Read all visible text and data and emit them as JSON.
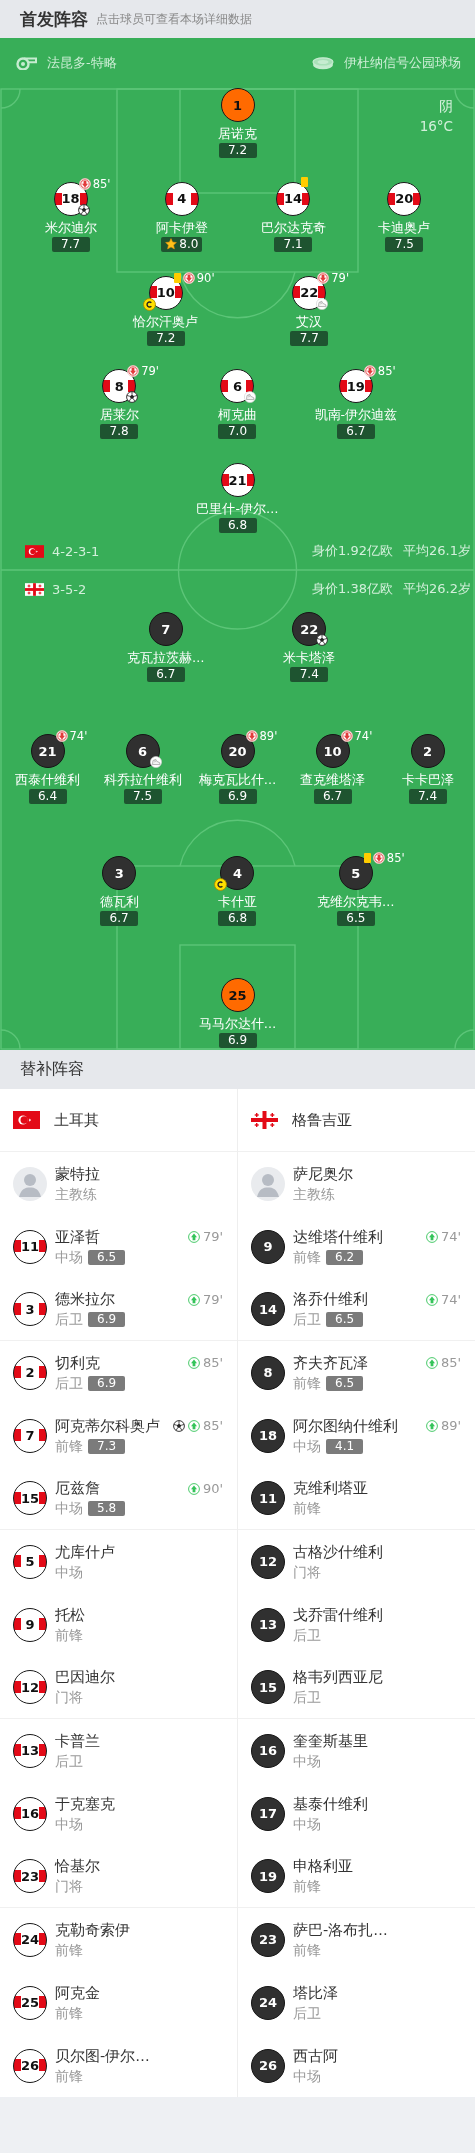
{
  "header": {
    "title": "首发阵容",
    "hint": "点击球员可查看本场详细数据"
  },
  "match_info": {
    "referee": "法昆多-特略",
    "stadium": "伊杜纳信号公园球场",
    "weather": "阴",
    "temperature": "16°C"
  },
  "lineups": [
    {
      "kind": "turkey",
      "formation": "4-2-3-1",
      "market_value": "身价1.92亿欧",
      "average_age": "平均26.1岁",
      "rows": [
        {
          "players": [
            {
              "number": "1",
              "name": "居诺克",
              "rating": "7.2",
              "goalkeeper": true,
              "captain": false,
              "best": false
            }
          ]
        },
        {
          "players": [
            {
              "number": "18",
              "name": "米尔迪尔",
              "rating": "7.7",
              "goalkeeper": false,
              "captain": false,
              "best": false,
              "events": [
                {
                  "kind": "sub_off",
                  "minute": "85'"
                },
                {
                  "kind": "goal"
                }
              ]
            },
            {
              "number": "4",
              "name": "阿卡伊登",
              "rating": "8.0",
              "goalkeeper": false,
              "captain": false,
              "best": true
            },
            {
              "number": "14",
              "name": "巴尔达克奇",
              "rating": "7.1",
              "goalkeeper": false,
              "captain": false,
              "best": false,
              "events": [
                {
                  "kind": "yellow_card"
                }
              ]
            },
            {
              "number": "20",
              "name": "卡迪奥卢",
              "rating": "7.5",
              "goalkeeper": false,
              "captain": false,
              "best": false
            }
          ]
        },
        {
          "players": [
            {
              "number": "10",
              "name": "恰尔汗奥卢",
              "rating": "7.2",
              "goalkeeper": false,
              "captain": true,
              "best": false,
              "events": [
                {
                  "kind": "yellow_card"
                },
                {
                  "kind": "sub_off",
                  "minute": "90'"
                }
              ]
            },
            {
              "number": "22",
              "name": "艾汉",
              "rating": "7.7",
              "goalkeeper": false,
              "captain": false,
              "best": false,
              "events": [
                {
                  "kind": "sub_off",
                  "minute": "79'"
                },
                {
                  "kind": "assist"
                }
              ]
            }
          ]
        },
        {
          "players": [
            {
              "number": "8",
              "name": "居莱尔",
              "rating": "7.8",
              "goalkeeper": false,
              "captain": false,
              "best": false,
              "events": [
                {
                  "kind": "sub_off",
                  "minute": "79'"
                },
                {
                  "kind": "goal"
                }
              ]
            },
            {
              "number": "6",
              "name": "柯克曲",
              "rating": "7.0",
              "goalkeeper": false,
              "captain": false,
              "best": false,
              "events": [
                {
                  "kind": "assist"
                }
              ]
            },
            {
              "number": "19",
              "name": "凯南-伊尔迪兹",
              "rating": "6.7",
              "goalkeeper": false,
              "captain": false,
              "best": false,
              "events": [
                {
                  "kind": "sub_off",
                  "minute": "85'"
                }
              ]
            }
          ]
        },
        {
          "players": [
            {
              "number": "21",
              "name": "巴里什-伊尔…",
              "rating": "6.8",
              "goalkeeper": false,
              "captain": false,
              "best": false
            }
          ]
        }
      ]
    },
    {
      "kind": "georgia",
      "formation": "3-5-2",
      "market_value": "身价1.38亿欧",
      "average_age": "平均26.2岁",
      "rows": [
        {
          "players": [
            {
              "number": "7",
              "name": "克瓦拉茨赫…",
              "rating": "6.7",
              "goalkeeper": false,
              "captain": false,
              "best": false
            },
            {
              "number": "22",
              "name": "米卡塔泽",
              "rating": "7.4",
              "goalkeeper": false,
              "captain": false,
              "best": false,
              "events": [
                {
                  "kind": "goal"
                }
              ]
            }
          ]
        },
        {
          "players": [
            {
              "number": "21",
              "name": "西泰什维利",
              "rating": "6.4",
              "goalkeeper": false,
              "captain": false,
              "best": false,
              "events": [
                {
                  "kind": "sub_off",
                  "minute": "74'"
                }
              ]
            },
            {
              "number": "6",
              "name": "科乔拉什维利",
              "rating": "7.5",
              "goalkeeper": false,
              "captain": false,
              "best": false,
              "events": [
                {
                  "kind": "assist"
                }
              ]
            },
            {
              "number": "20",
              "name": "梅克瓦比什…",
              "rating": "6.9",
              "goalkeeper": false,
              "captain": false,
              "best": false,
              "events": [
                {
                  "kind": "sub_off",
                  "minute": "89'"
                }
              ]
            },
            {
              "number": "10",
              "name": "查克维塔泽",
              "rating": "6.7",
              "goalkeeper": false,
              "captain": false,
              "best": false,
              "events": [
                {
                  "kind": "sub_off",
                  "minute": "74'"
                }
              ]
            },
            {
              "number": "2",
              "name": "卡卡巴泽",
              "rating": "7.4",
              "goalkeeper": false,
              "captain": false,
              "best": false
            }
          ]
        },
        {
          "players": [
            {
              "number": "3",
              "name": "德瓦利",
              "rating": "6.7",
              "goalkeeper": false,
              "captain": false,
              "best": false
            },
            {
              "number": "4",
              "name": "卡什亚",
              "rating": "6.8",
              "goalkeeper": false,
              "captain": true,
              "best": false
            },
            {
              "number": "5",
              "name": "克维尔克韦…",
              "rating": "6.5",
              "goalkeeper": false,
              "captain": false,
              "best": false,
              "events": [
                {
                  "kind": "yellow_card"
                },
                {
                  "kind": "sub_off",
                  "minute": "85'"
                }
              ]
            }
          ]
        },
        {
          "players": [
            {
              "number": "25",
              "name": "马马尔达什…",
              "rating": "6.9",
              "goalkeeper": true,
              "captain": false,
              "best": false
            }
          ]
        }
      ]
    }
  ],
  "substitutes": {
    "title": "替补阵容",
    "teams": [
      {
        "name": "土耳其",
        "kind": "turkey",
        "coach": {
          "name": "蒙特拉",
          "role": "主教练"
        },
        "players": [
          {
            "number": "11",
            "name": "亚泽哲",
            "position": "中场",
            "rating": "6.5",
            "events": [
              {
                "kind": "sub_on",
                "minute": "79'"
              }
            ]
          },
          {
            "number": "3",
            "name": "德米拉尔",
            "position": "后卫",
            "rating": "6.9",
            "events": [
              {
                "kind": "sub_on",
                "minute": "79'"
              }
            ]
          },
          {
            "number": "2",
            "name": "切利克",
            "position": "后卫",
            "rating": "6.9",
            "events": [
              {
                "kind": "sub_on",
                "minute": "85'"
              }
            ]
          },
          {
            "number": "7",
            "name": "阿克蒂尔科奥卢",
            "position": "前锋",
            "rating": "7.3",
            "events": [
              {
                "kind": "goal"
              },
              {
                "kind": "sub_on",
                "minute": "85'"
              }
            ]
          },
          {
            "number": "15",
            "name": "厄兹詹",
            "position": "中场",
            "rating": "5.8",
            "events": [
              {
                "kind": "sub_on",
                "minute": "90'"
              }
            ]
          },
          {
            "number": "5",
            "name": "尤库什卢",
            "position": "中场"
          },
          {
            "number": "9",
            "name": "托松",
            "position": "前锋"
          },
          {
            "number": "12",
            "name": "巴因迪尔",
            "position": "门将"
          },
          {
            "number": "13",
            "name": "卡普兰",
            "position": "后卫"
          },
          {
            "number": "16",
            "name": "于克塞克",
            "position": "中场"
          },
          {
            "number": "23",
            "name": "恰基尔",
            "position": "门将"
          },
          {
            "number": "24",
            "name": "克勒奇索伊",
            "position": "前锋"
          },
          {
            "number": "25",
            "name": "阿克金",
            "position": "前锋"
          },
          {
            "number": "26",
            "name": "贝尔图-伊尔…",
            "position": "前锋"
          }
        ]
      },
      {
        "name": "格鲁吉亚",
        "kind": "georgia",
        "coach": {
          "name": "萨尼奥尔",
          "role": "主教练"
        },
        "players": [
          {
            "number": "9",
            "name": "达维塔什维利",
            "position": "前锋",
            "rating": "6.2",
            "events": [
              {
                "kind": "sub_on",
                "minute": "74'"
              }
            ]
          },
          {
            "number": "14",
            "name": "洛乔什维利",
            "position": "后卫",
            "rating": "6.5",
            "events": [
              {
                "kind": "sub_on",
                "minute": "74'"
              }
            ]
          },
          {
            "number": "8",
            "name": "齐夫齐瓦泽",
            "position": "前锋",
            "rating": "6.5",
            "events": [
              {
                "kind": "sub_on",
                "minute": "85'"
              }
            ]
          },
          {
            "number": "18",
            "name": "阿尔图纳什维利",
            "position": "中场",
            "rating": "4.1",
            "events": [
              {
                "kind": "sub_on",
                "minute": "89'"
              }
            ]
          },
          {
            "number": "11",
            "name": "克维利塔亚",
            "position": "前锋"
          },
          {
            "number": "12",
            "name": "古格沙什维利",
            "position": "门将"
          },
          {
            "number": "13",
            "name": "戈乔雷什维利",
            "position": "后卫"
          },
          {
            "number": "15",
            "name": "格韦列西亚尼",
            "position": "后卫"
          },
          {
            "number": "16",
            "name": "奎奎斯基里",
            "position": "中场"
          },
          {
            "number": "17",
            "name": "基泰什维利",
            "position": "中场"
          },
          {
            "number": "19",
            "name": "申格利亚",
            "position": "前锋"
          },
          {
            "number": "23",
            "name": "萨巴-洛布扎…",
            "position": "前锋"
          },
          {
            "number": "24",
            "name": "塔比泽",
            "position": "后卫"
          },
          {
            "number": "26",
            "name": "西古阿",
            "position": "中场"
          }
        ]
      }
    ]
  }
}
